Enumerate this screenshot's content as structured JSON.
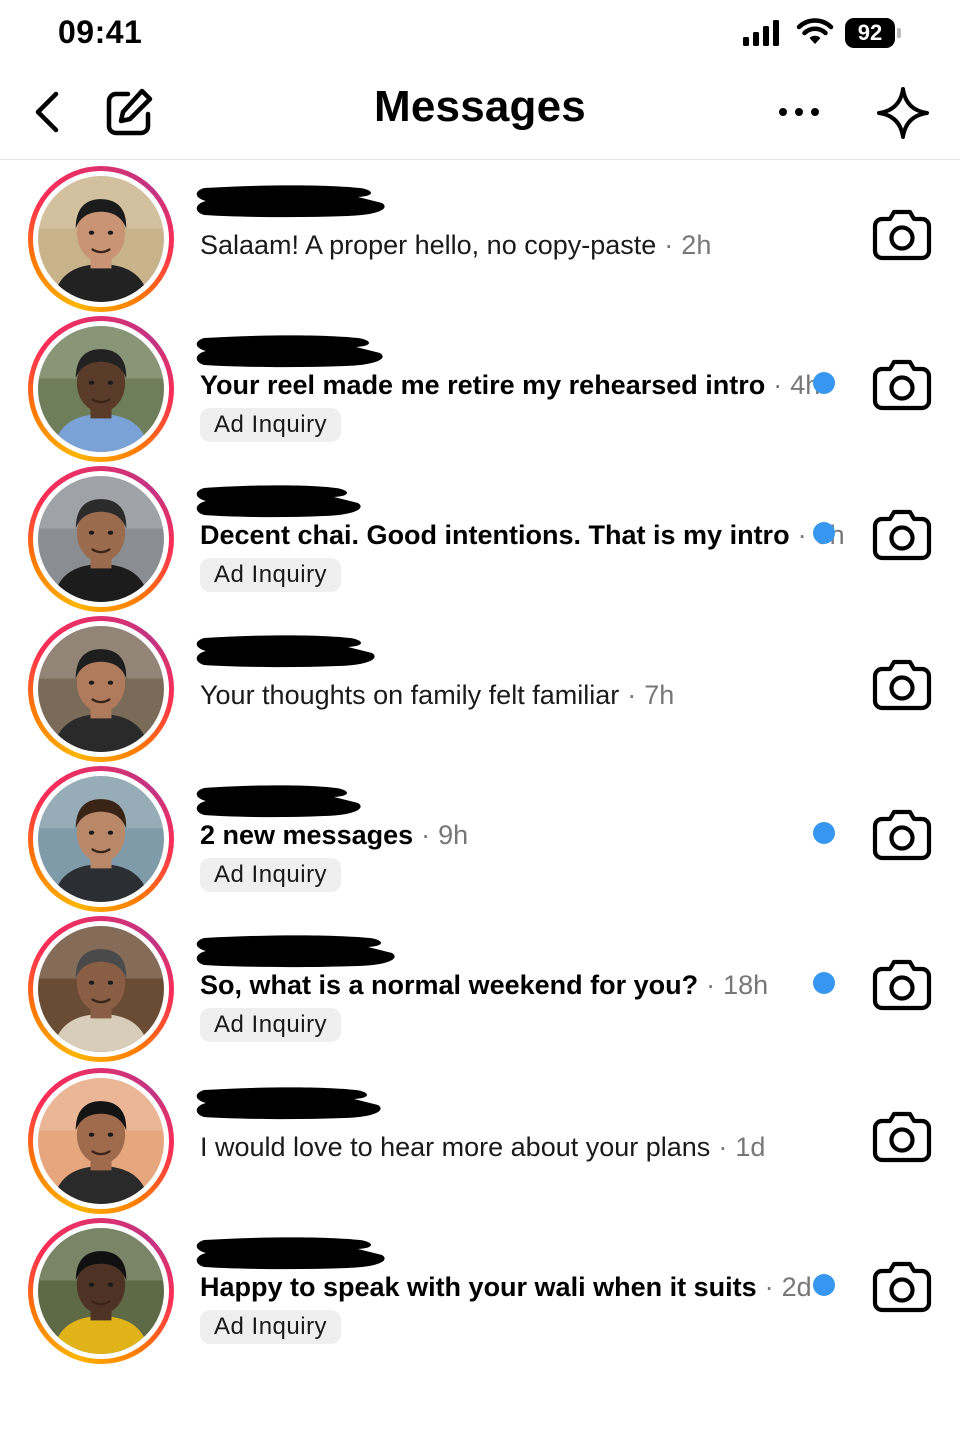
{
  "status_bar": {
    "time": "09:41",
    "battery": "92"
  },
  "header": {
    "title": "Messages"
  },
  "colors": {
    "unread": "#3797f0",
    "tag_bg": "#efefef",
    "ring_start": "#ffb400",
    "ring_end": "#c13584"
  },
  "threads": [
    {
      "preview": "Salaam! A proper hello, no copy-paste",
      "time": "2h",
      "unread": false,
      "tag": ""
    },
    {
      "preview": "Your reel made me retire my rehearsed intro",
      "time": "4h",
      "unread": true,
      "tag": "Ad Inquiry"
    },
    {
      "preview": "Decent chai. Good intentions. That is my intro",
      "time": "6h",
      "unread": true,
      "tag": "Ad Inquiry"
    },
    {
      "preview": "Your thoughts on family felt familiar",
      "time": "7h",
      "unread": false,
      "tag": ""
    },
    {
      "preview": "2 new messages",
      "time": "9h",
      "unread": true,
      "tag": "Ad Inquiry"
    },
    {
      "preview": "So, what is a normal weekend for you?",
      "time": "18h",
      "unread": true,
      "tag": "Ad Inquiry"
    },
    {
      "preview": "I would love to hear more about your plans",
      "time": "1d",
      "unread": false,
      "tag": ""
    },
    {
      "preview": "Happy to speak with your wali when it suits",
      "time": "2d",
      "unread": true,
      "tag": "Ad Inquiry"
    }
  ],
  "separator": "·"
}
